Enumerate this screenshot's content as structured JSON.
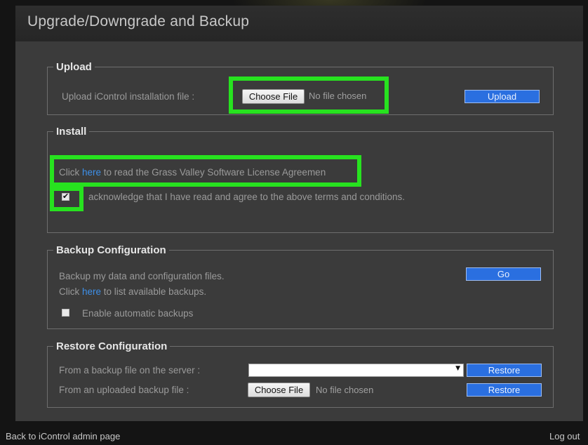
{
  "header": {
    "title": "Upgrade/Downgrade and Backup"
  },
  "upload": {
    "legend": "Upload",
    "label": "Upload iControl installation file :",
    "choose_file": "Choose File",
    "no_file": "No file chosen",
    "upload_button": "Upload"
  },
  "install": {
    "legend": "Install",
    "click_prefix": "Click ",
    "here_link": "here",
    "agreement_suffix": " to read the Grass Valley Software License Agreemen",
    "acknowledge_checked": true,
    "acknowledge_text": "acknowledge that I have read and agree to the above terms and conditions."
  },
  "backup": {
    "legend": "Backup Configuration",
    "backup_text": "Backup my data and configuration files.",
    "go_button": "Go",
    "click_prefix": "Click ",
    "here_link": "here",
    "list_suffix": " to list available backups.",
    "auto_backup_checked": false,
    "auto_backup_label": "Enable automatic backups"
  },
  "restore": {
    "legend": "Restore Configuration",
    "server_label": "From a backup file on the server :",
    "server_selected": "",
    "restore_button_1": "Restore",
    "uploaded_label": "From an uploaded backup file :",
    "choose_file": "Choose File",
    "no_file": "No file chosen",
    "restore_button_2": "Restore"
  },
  "footer": {
    "back_link": "Back to iControl admin page",
    "logout_link": "Log out"
  },
  "colors": {
    "highlight": "#27e21f",
    "button_blue": "#2a6fe0",
    "link_blue": "#3d8fe8"
  }
}
